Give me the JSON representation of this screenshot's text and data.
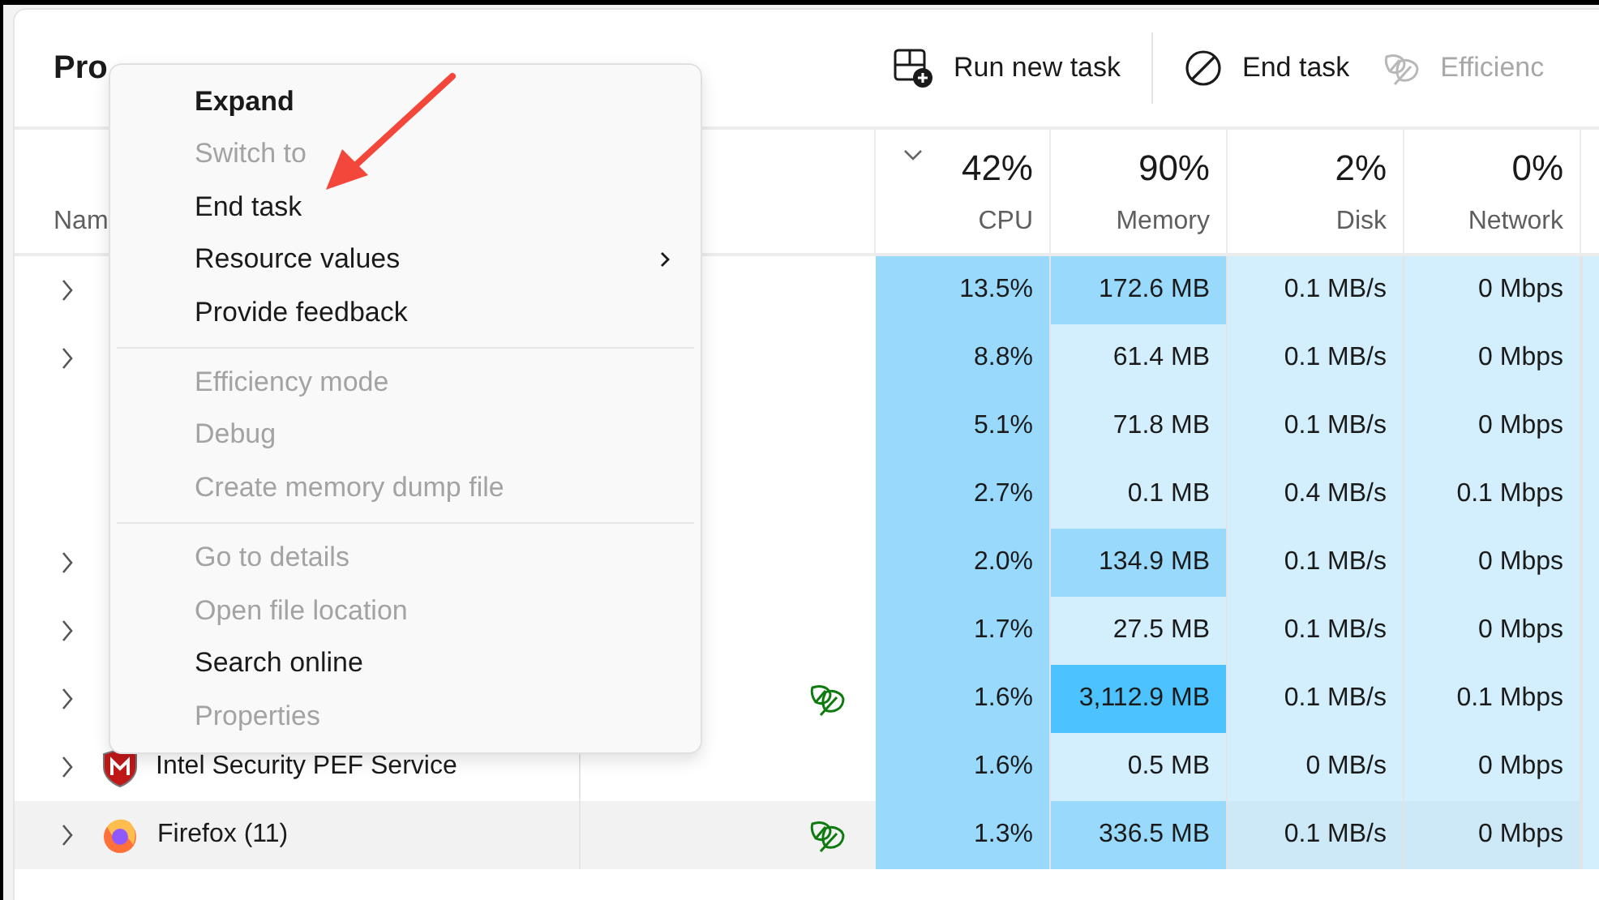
{
  "window": {
    "title": "Pro"
  },
  "toolbar": [
    {
      "kind": "run",
      "label": "Run new task",
      "disabled": false
    },
    {
      "kind": "end",
      "label": "End task",
      "disabled": false
    },
    {
      "kind": "efficiency",
      "label": "Efficienc",
      "disabled": true
    }
  ],
  "table": {
    "name_column": "Nam",
    "columns": [
      {
        "value": "42%",
        "label": "CPU",
        "sorted": true
      },
      {
        "value": "90%",
        "label": "Memory",
        "sorted": false
      },
      {
        "value": "2%",
        "label": "Disk",
        "sorted": false
      },
      {
        "value": "0%",
        "label": "Network",
        "sorted": false
      }
    ],
    "rows": [
      {
        "expandable": true,
        "efficiency": false,
        "hovered": false,
        "cells": [
          {
            "text": "13.5%",
            "color": "#99d9fb"
          },
          {
            "text": "172.6 MB",
            "color": "#99d9fb"
          },
          {
            "text": "0.1 MB/s",
            "color": "#d3effd"
          },
          {
            "text": "0 Mbps",
            "color": "#d3effd"
          }
        ]
      },
      {
        "expandable": true,
        "efficiency": false,
        "hovered": false,
        "cells": [
          {
            "text": "8.8%",
            "color": "#99d9fb"
          },
          {
            "text": "61.4 MB",
            "color": "#d3effd"
          },
          {
            "text": "0.1 MB/s",
            "color": "#d3effd"
          },
          {
            "text": "0 Mbps",
            "color": "#d3effd"
          }
        ]
      },
      {
        "expandable": false,
        "efficiency": false,
        "hovered": false,
        "cells": [
          {
            "text": "5.1%",
            "color": "#99d9fb"
          },
          {
            "text": "71.8 MB",
            "color": "#d3effd"
          },
          {
            "text": "0.1 MB/s",
            "color": "#d3effd"
          },
          {
            "text": "0 Mbps",
            "color": "#d3effd"
          }
        ]
      },
      {
        "expandable": false,
        "efficiency": false,
        "hovered": false,
        "cells": [
          {
            "text": "2.7%",
            "color": "#99d9fb"
          },
          {
            "text": "0.1 MB",
            "color": "#d3effd"
          },
          {
            "text": "0.4 MB/s",
            "color": "#d3effd"
          },
          {
            "text": "0.1 Mbps",
            "color": "#d3effd"
          }
        ]
      },
      {
        "expandable": true,
        "efficiency": false,
        "hovered": false,
        "cells": [
          {
            "text": "2.0%",
            "color": "#99d9fb"
          },
          {
            "text": "134.9 MB",
            "color": "#99d9fb"
          },
          {
            "text": "0.1 MB/s",
            "color": "#d3effd"
          },
          {
            "text": "0 Mbps",
            "color": "#d3effd"
          }
        ]
      },
      {
        "expandable": true,
        "efficiency": false,
        "hovered": false,
        "cells": [
          {
            "text": "1.7%",
            "color": "#99d9fb"
          },
          {
            "text": "27.5 MB",
            "color": "#d3effd"
          },
          {
            "text": "0.1 MB/s",
            "color": "#d3effd"
          },
          {
            "text": "0 Mbps",
            "color": "#d3effd"
          }
        ]
      },
      {
        "expandable": true,
        "efficiency": true,
        "hovered": false,
        "cells": [
          {
            "text": "1.6%",
            "color": "#99d9fb"
          },
          {
            "text": "3,112.9 MB",
            "color": "#4cc2ff"
          },
          {
            "text": "0.1 MB/s",
            "color": "#d3effd"
          },
          {
            "text": "0.1 Mbps",
            "color": "#d3effd"
          }
        ]
      },
      {
        "expandable": true,
        "efficiency": false,
        "hovered": false,
        "name": "Intel Security PEF Service",
        "cells": [
          {
            "text": "1.6%",
            "color": "#99d9fb"
          },
          {
            "text": "0.5 MB",
            "color": "#d3effd"
          },
          {
            "text": "0 MB/s",
            "color": "#d3effd"
          },
          {
            "text": "0 Mbps",
            "color": "#d3effd"
          }
        ]
      },
      {
        "expandable": true,
        "efficiency": true,
        "hovered": true,
        "name": "Firefox (11)",
        "cells": [
          {
            "text": "1.3%",
            "color": "#99d9fb"
          },
          {
            "text": "336.5 MB",
            "color": "#99d9fb"
          },
          {
            "text": "0.1 MB/s",
            "color": "#cde9f7"
          },
          {
            "text": "0 Mbps",
            "color": "#cde9f7"
          }
        ]
      }
    ]
  },
  "context_menu": [
    {
      "kind": "item",
      "label": "Expand",
      "default": true,
      "disabled": false,
      "submenu": false
    },
    {
      "kind": "item",
      "label": "Switch to",
      "default": false,
      "disabled": true,
      "submenu": false
    },
    {
      "kind": "item",
      "label": "End task",
      "default": false,
      "disabled": false,
      "submenu": false
    },
    {
      "kind": "item",
      "label": "Resource values",
      "default": false,
      "disabled": false,
      "submenu": true
    },
    {
      "kind": "item",
      "label": "Provide feedback",
      "default": false,
      "disabled": false,
      "submenu": false
    },
    {
      "kind": "separator"
    },
    {
      "kind": "item",
      "label": "Efficiency mode",
      "default": false,
      "disabled": true,
      "submenu": false
    },
    {
      "kind": "item",
      "label": "Debug",
      "default": false,
      "disabled": true,
      "submenu": false
    },
    {
      "kind": "item",
      "label": "Create memory dump file",
      "default": false,
      "disabled": true,
      "submenu": false
    },
    {
      "kind": "separator"
    },
    {
      "kind": "item",
      "label": "Go to details",
      "default": false,
      "disabled": true,
      "submenu": false
    },
    {
      "kind": "item",
      "label": "Open file location",
      "default": false,
      "disabled": true,
      "submenu": false
    },
    {
      "kind": "item",
      "label": "Search online",
      "default": false,
      "disabled": false,
      "submenu": false
    },
    {
      "kind": "item",
      "label": "Properties",
      "default": false,
      "disabled": true,
      "submenu": false
    }
  ],
  "annotation": {
    "kind": "arrow"
  }
}
